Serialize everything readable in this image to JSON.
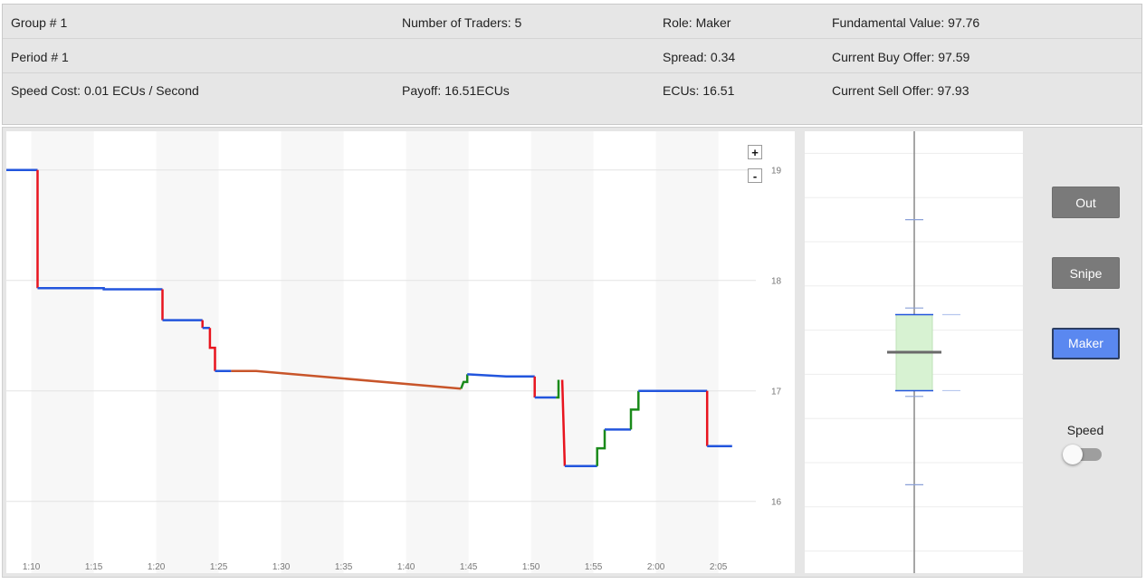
{
  "info": {
    "group": "Group # 1",
    "traders": "Number of Traders: 5",
    "role": "Role: Maker",
    "fundamental": "Fundamental Value: 97.76",
    "period": "Period # 1",
    "spread": "Spread: 0.34",
    "buy_offer": "Current Buy Offer: 97.59",
    "speed_cost": "Speed Cost: 0.01 ECUs / Second",
    "payoff": "Payoff: 16.51ECUs",
    "ecus": "ECUs: 16.51",
    "sell_offer": "Current Sell Offer: 97.93"
  },
  "controls": {
    "zoom_in": "+",
    "zoom_out": "-",
    "out_label": "Out",
    "snipe_label": "Snipe",
    "maker_label": "Maker",
    "speed_label": "Speed",
    "speed_on": false
  },
  "colors": {
    "blue": "#2255dd",
    "red": "#e8141e",
    "green": "#1a8a1a",
    "orange": "#c8552a",
    "spread_fill": "#d7f2d2"
  },
  "chart_data": [
    {
      "type": "line",
      "x_unit": "seconds",
      "x_ticks": [
        "1:10",
        "1:15",
        "1:20",
        "1:25",
        "1:30",
        "1:35",
        "1:40",
        "1:45",
        "1:50",
        "1:55",
        "2:00",
        "2:05"
      ],
      "y_ticks": [
        "19",
        "18",
        "17",
        "16"
      ],
      "xlim": [
        68,
        128
      ],
      "ylim": [
        15.35,
        19.35
      ],
      "grid": true,
      "segments": [
        {
          "color": "blue",
          "points": [
            [
              68,
              19.0
            ],
            [
              70.5,
              19.0
            ]
          ]
        },
        {
          "color": "red",
          "points": [
            [
              70.5,
              19.0
            ],
            [
              70.5,
              17.93
            ]
          ]
        },
        {
          "color": "blue",
          "points": [
            [
              70.5,
              17.93
            ],
            [
              75.8,
              17.93
            ],
            [
              75.8,
              17.92
            ],
            [
              80.5,
              17.92
            ]
          ]
        },
        {
          "color": "red",
          "points": [
            [
              80.5,
              17.92
            ],
            [
              80.5,
              17.64
            ]
          ]
        },
        {
          "color": "blue",
          "points": [
            [
              80.5,
              17.64
            ],
            [
              83.7,
              17.64
            ]
          ]
        },
        {
          "color": "red",
          "points": [
            [
              83.7,
              17.64
            ],
            [
              83.7,
              17.57
            ]
          ]
        },
        {
          "color": "blue",
          "points": [
            [
              83.7,
              17.57
            ],
            [
              84.3,
              17.57
            ]
          ]
        },
        {
          "color": "red",
          "points": [
            [
              84.3,
              17.57
            ],
            [
              84.3,
              17.39
            ],
            [
              84.7,
              17.39
            ],
            [
              84.7,
              17.18
            ]
          ]
        },
        {
          "color": "blue",
          "points": [
            [
              84.7,
              17.18
            ],
            [
              86.0,
              17.18
            ]
          ]
        },
        {
          "color": "orange",
          "points": [
            [
              86.0,
              17.18
            ],
            [
              88.0,
              17.18
            ],
            [
              104.4,
              17.02
            ]
          ]
        },
        {
          "color": "green",
          "points": [
            [
              104.4,
              17.02
            ],
            [
              104.6,
              17.08
            ],
            [
              104.9,
              17.08
            ],
            [
              104.9,
              17.15
            ]
          ]
        },
        {
          "color": "blue",
          "points": [
            [
              104.9,
              17.15
            ],
            [
              108.0,
              17.13
            ],
            [
              110.3,
              17.13
            ]
          ]
        },
        {
          "color": "red",
          "points": [
            [
              110.3,
              17.13
            ],
            [
              110.3,
              16.94
            ]
          ]
        },
        {
          "color": "blue",
          "points": [
            [
              110.3,
              16.94
            ],
            [
              112.0,
              16.94
            ]
          ]
        },
        {
          "color": "green",
          "points": [
            [
              112.0,
              16.94
            ],
            [
              112.2,
              16.94
            ],
            [
              112.2,
              17.1
            ]
          ]
        },
        {
          "color": "red",
          "points": [
            [
              112.5,
              17.1
            ],
            [
              112.7,
              16.32
            ]
          ]
        },
        {
          "color": "blue",
          "points": [
            [
              112.7,
              16.32
            ],
            [
              115.3,
              16.32
            ]
          ]
        },
        {
          "color": "green",
          "points": [
            [
              115.3,
              16.32
            ],
            [
              115.3,
              16.48
            ],
            [
              115.9,
              16.48
            ],
            [
              115.9,
              16.65
            ]
          ]
        },
        {
          "color": "blue",
          "points": [
            [
              115.9,
              16.65
            ],
            [
              118.0,
              16.65
            ]
          ]
        },
        {
          "color": "green",
          "points": [
            [
              118.0,
              16.65
            ],
            [
              118.0,
              16.83
            ],
            [
              118.6,
              16.83
            ],
            [
              118.6,
              17.0
            ]
          ]
        },
        {
          "color": "blue",
          "points": [
            [
              118.6,
              17.0
            ],
            [
              124.1,
              17.0
            ]
          ]
        },
        {
          "color": "red",
          "points": [
            [
              124.1,
              17.0
            ],
            [
              124.1,
              16.5
            ]
          ]
        },
        {
          "color": "blue",
          "points": [
            [
              124.1,
              16.5
            ],
            [
              126.1,
              16.5
            ]
          ]
        }
      ]
    },
    {
      "type": "bar",
      "ylim": [
        -5,
        5
      ],
      "center": 0,
      "fundamental": 0,
      "buy_offer": -0.87,
      "sell_offer": 0.85,
      "others": [
        3.0,
        1.0,
        -1.0,
        -3.0
      ],
      "others_faint": [
        0.85,
        -0.87
      ]
    }
  ]
}
